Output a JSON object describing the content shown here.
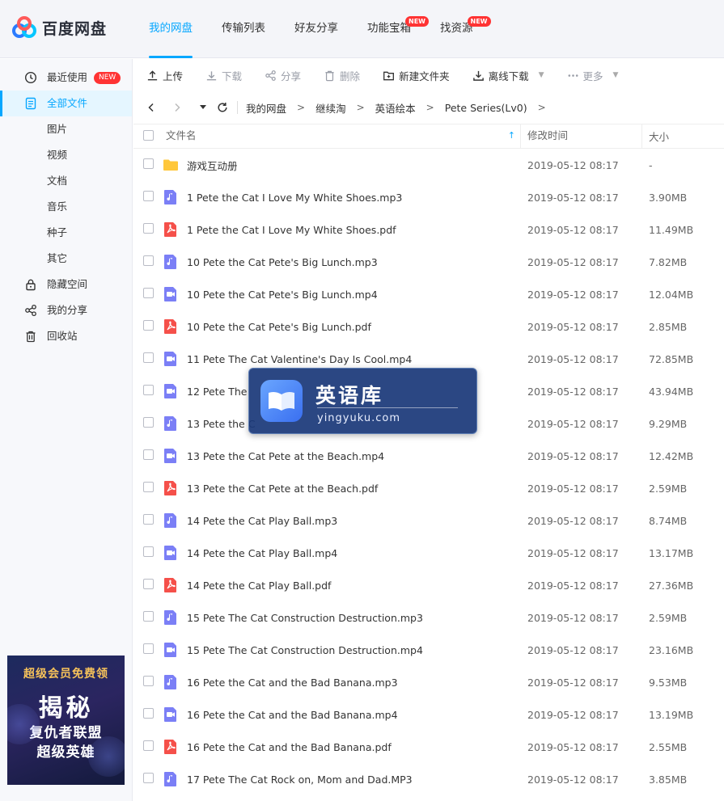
{
  "app": {
    "logo_text": "百度网盘"
  },
  "topnav": [
    {
      "label": "我的网盘",
      "active": true,
      "badge": ""
    },
    {
      "label": "传输列表",
      "active": false,
      "badge": ""
    },
    {
      "label": "好友分享",
      "active": false,
      "badge": ""
    },
    {
      "label": "功能宝箱",
      "active": false,
      "badge": "NEW"
    },
    {
      "label": "找资源",
      "active": false,
      "badge": "NEW"
    }
  ],
  "sidebar": {
    "recent": {
      "label": "最近使用",
      "badge": "NEW"
    },
    "all_files": "全部文件",
    "pictures": "图片",
    "videos": "视频",
    "documents": "文档",
    "music": "音乐",
    "torrents": "种子",
    "others": "其它",
    "hidden_space": "隐藏空间",
    "my_share": "我的分享",
    "recycle_bin": "回收站"
  },
  "ad": {
    "headline": "超级会员免费领",
    "big": "揭秘",
    "line1": "复仇者联盟",
    "line2": "超级英雄"
  },
  "toolbar": {
    "upload": "上传",
    "download": "下载",
    "share": "分享",
    "delete": "删除",
    "new_folder": "新建文件夹",
    "offline_download": "离线下载",
    "more": "更多"
  },
  "path": {
    "crumbs": [
      "我的网盘",
      "继续淘",
      "英语绘本",
      "Pete Series(Lv0)"
    ]
  },
  "table": {
    "col_name": "文件名",
    "col_time": "修改时间",
    "col_size": "大小",
    "rows": [
      {
        "name": "游戏互动册",
        "type": "folder",
        "time": "2019-05-12 08:17",
        "size": "-"
      },
      {
        "name": "1 Pete the Cat I Love My White Shoes.mp3",
        "type": "audio",
        "time": "2019-05-12 08:17",
        "size": "3.90MB"
      },
      {
        "name": "1 Pete the Cat I Love My White Shoes.pdf",
        "type": "pdf",
        "time": "2019-05-12 08:17",
        "size": "11.49MB"
      },
      {
        "name": "10 Pete the Cat Pete's Big Lunch.mp3",
        "type": "audio",
        "time": "2019-05-12 08:17",
        "size": "7.82MB"
      },
      {
        "name": "10 Pete the Cat Pete's Big Lunch.mp4",
        "type": "video",
        "time": "2019-05-12 08:17",
        "size": "12.04MB"
      },
      {
        "name": "10 Pete the Cat Pete's Big Lunch.pdf",
        "type": "pdf",
        "time": "2019-05-12 08:17",
        "size": "2.85MB"
      },
      {
        "name": "11 Pete The Cat Valentine's Day Is Cool.mp4",
        "type": "video",
        "time": "2019-05-12 08:17",
        "size": "72.85MB"
      },
      {
        "name": "12 Pete The",
        "type": "video",
        "time": "2019-05-12 08:17",
        "size": "43.94MB"
      },
      {
        "name": "13 Pete the C",
        "type": "audio",
        "time": "2019-05-12 08:17",
        "size": "9.29MB"
      },
      {
        "name": "13 Pete the Cat Pete at the Beach.mp4",
        "type": "video",
        "time": "2019-05-12 08:17",
        "size": "12.42MB"
      },
      {
        "name": "13 Pete the Cat Pete at the Beach.pdf",
        "type": "pdf",
        "time": "2019-05-12 08:17",
        "size": "2.59MB"
      },
      {
        "name": "14 Pete the Cat Play Ball.mp3",
        "type": "audio",
        "time": "2019-05-12 08:17",
        "size": "8.74MB"
      },
      {
        "name": "14 Pete the Cat Play Ball.mp4",
        "type": "video",
        "time": "2019-05-12 08:17",
        "size": "13.17MB"
      },
      {
        "name": "14 Pete the Cat Play Ball.pdf",
        "type": "pdf",
        "time": "2019-05-12 08:17",
        "size": "27.36MB"
      },
      {
        "name": "15 Pete The Cat Construction Destruction.mp3",
        "type": "audio",
        "time": "2019-05-12 08:17",
        "size": "2.59MB"
      },
      {
        "name": "15 Pete The Cat Construction Destruction.mp4",
        "type": "video",
        "time": "2019-05-12 08:17",
        "size": "23.16MB"
      },
      {
        "name": "16 Pete the Cat and the Bad Banana.mp3",
        "type": "audio",
        "time": "2019-05-12 08:17",
        "size": "9.53MB"
      },
      {
        "name": "16 Pete the Cat and the Bad Banana.mp4",
        "type": "video",
        "time": "2019-05-12 08:17",
        "size": "13.19MB"
      },
      {
        "name": "16 Pete the Cat and the Bad Banana.pdf",
        "type": "pdf",
        "time": "2019-05-12 08:17",
        "size": "2.55MB"
      },
      {
        "name": "17 Pete The Cat  Rock on, Mom and Dad.MP3",
        "type": "audio",
        "time": "2019-05-12 08:17",
        "size": "3.85MB"
      }
    ]
  },
  "watermark": {
    "title": "英语库",
    "url": "yingyuku.com"
  },
  "colors": {
    "accent": "#06a7ff",
    "folder": "#ffc73b",
    "audio": "#7b7ff6",
    "video": "#7b7ff6",
    "pdf": "#f5504a"
  }
}
